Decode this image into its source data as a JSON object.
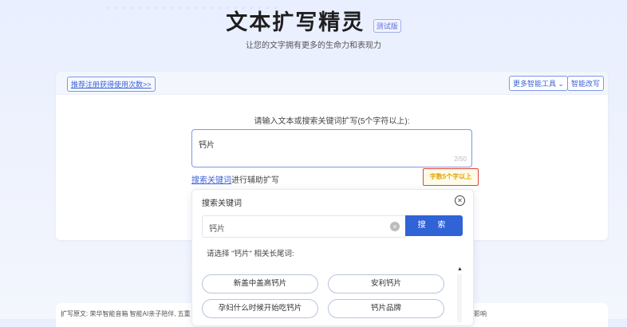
{
  "header": {
    "title": "文本扩写精灵",
    "badge": "测试版",
    "subtitle": "让您的文字拥有更多的生命力和表现力"
  },
  "toolbar": {
    "tip_link": "推荐注册获得使用次数>>",
    "more_tools": "更多智能工具",
    "rewrite": "智能改写"
  },
  "editor": {
    "prompt": "请输入文本或搜索关键词扩写(5个字符以上):",
    "value": "钙片",
    "char_count": "2/50",
    "search_link": "搜索关键词",
    "search_suffix": "进行辅助扩写",
    "warning": "字数5个字以上"
  },
  "keyword_dropdown": {
    "title": "搜索关键词",
    "input_value": "钙片",
    "search_button": "搜 索",
    "hint": "请选择 \"钙片\" 相关长尾词:",
    "suggestions": [
      "新盖中盖高钙片",
      "安利钙片",
      "孕妇什么时候开始吃钙片",
      "钙片品牌"
    ]
  },
  "footer": {
    "left_text": "扩写原文: 荣华智能音箱 智能AI亲子陪伴, 五重",
    "right_text": "影响"
  },
  "colors": {
    "accent": "#2f63d6",
    "link": "#3b62d6",
    "warning_border": "#e0433d",
    "warning_text": "#e2a400"
  }
}
